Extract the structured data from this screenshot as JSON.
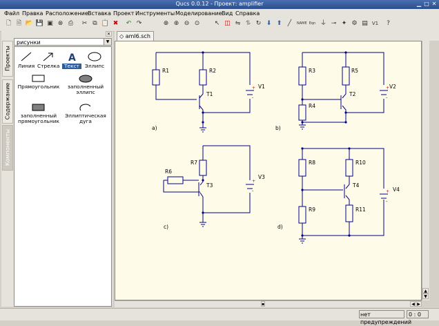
{
  "window": {
    "title": "Qucs 0.0.12 - Проект: amplifier"
  },
  "menu": [
    "Файл",
    "Правка",
    "Расположение",
    "Вставка",
    "Проект",
    "Инструменты",
    "Моделирование",
    "Вид",
    "Справка"
  ],
  "panel": {
    "tabs": [
      "Проекты",
      "Содержание",
      "Компоненты"
    ],
    "combo_value": "рисунки",
    "items": [
      "Линия",
      "Стрелка",
      "Текст",
      "Эллипс",
      "Прямоугольник",
      "заполненный эллипс",
      "заполненный прямоугольник",
      "Эллиптическая дуга"
    ]
  },
  "document": {
    "tab_label": "aml6.sch"
  },
  "schematic": {
    "labels_a": [
      "R1",
      "R2",
      "T1",
      "V1",
      "a)"
    ],
    "labels_b": [
      "R3",
      "R5",
      "T2",
      "V2",
      "R4",
      "b)"
    ],
    "labels_c": [
      "R7",
      "R6",
      "T3",
      "V3",
      "c)"
    ],
    "labels_d": [
      "R8",
      "R10",
      "T4",
      "V4",
      "R9",
      "R11",
      "d)"
    ],
    "plus": "+",
    "minus": "-"
  },
  "status": {
    "warnings": "нет предупреждений",
    "position": "0 : 0"
  }
}
